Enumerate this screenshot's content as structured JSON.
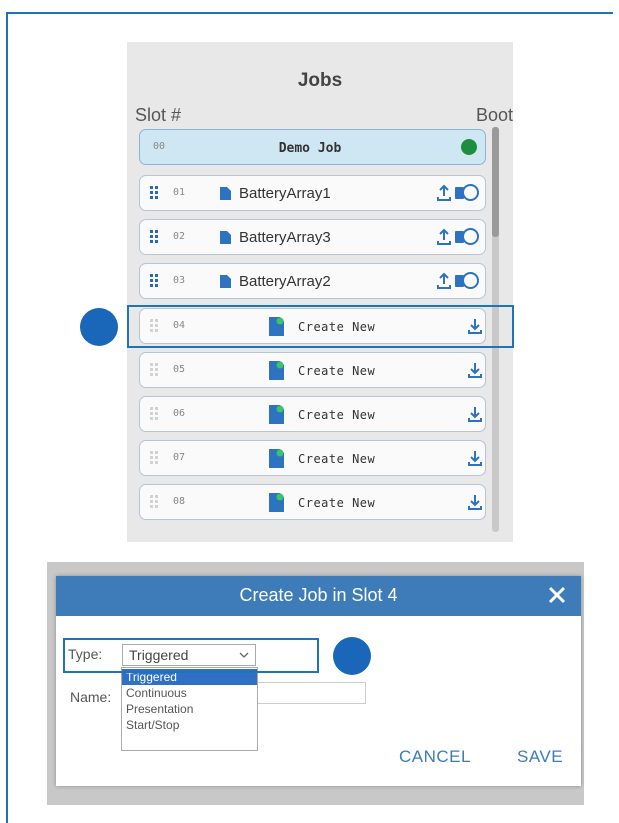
{
  "panel": {
    "title": "Jobs",
    "slot_header": "Slot #",
    "boot_header": "Boot"
  },
  "demo_row": {
    "slot": "00",
    "name": "Demo Job"
  },
  "job_rows": [
    {
      "slot": "01",
      "name": "BatteryArray1"
    },
    {
      "slot": "02",
      "name": "BatteryArray3"
    },
    {
      "slot": "03",
      "name": "BatteryArray2"
    }
  ],
  "empty_rows": [
    {
      "slot": "04",
      "label": "Create New"
    },
    {
      "slot": "05",
      "label": "Create New"
    },
    {
      "slot": "06",
      "label": "Create New"
    },
    {
      "slot": "07",
      "label": "Create New"
    },
    {
      "slot": "08",
      "label": "Create New"
    }
  ],
  "dialog": {
    "title": "Create Job in Slot 4",
    "type_label": "Type:",
    "type_value": "Triggered",
    "name_label": "Name:",
    "options": [
      "Triggered",
      "Continuous",
      "Presentation",
      "Start/Stop"
    ],
    "cancel_label": "CANCEL",
    "save_label": "SAVE"
  },
  "colors": {
    "accent": "#1f73b7",
    "boot_active": "#1e8e3e",
    "dialog_header": "#3d7cb9"
  }
}
